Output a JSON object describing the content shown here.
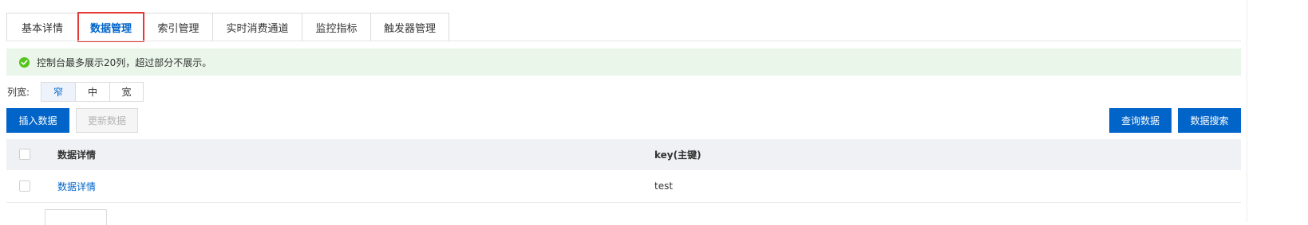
{
  "tabs": [
    {
      "label": "基本详情",
      "active": false
    },
    {
      "label": "数据管理",
      "active": true
    },
    {
      "label": "索引管理",
      "active": false
    },
    {
      "label": "实时消费通道",
      "active": false
    },
    {
      "label": "监控指标",
      "active": false
    },
    {
      "label": "触发器管理",
      "active": false
    }
  ],
  "alert": {
    "icon": "check-circle-icon",
    "text": "控制台最多展示20列，超过部分不展示。",
    "color": "#52c41a"
  },
  "column_width": {
    "label": "列宽:",
    "options": [
      "窄",
      "中",
      "宽"
    ],
    "selected": "窄"
  },
  "toolbar": {
    "insert_label": "插入数据",
    "update_label": "更新数据",
    "query_label": "查询数据",
    "search_label": "数据搜索"
  },
  "table": {
    "headers": [
      "数据详情",
      "key(主键)"
    ],
    "rows": [
      {
        "detail_link": "数据详情",
        "key": "test"
      }
    ]
  },
  "colors": {
    "primary": "#0064c8",
    "alert_bg": "#e9f6e9",
    "highlight_border": "#e53935"
  }
}
